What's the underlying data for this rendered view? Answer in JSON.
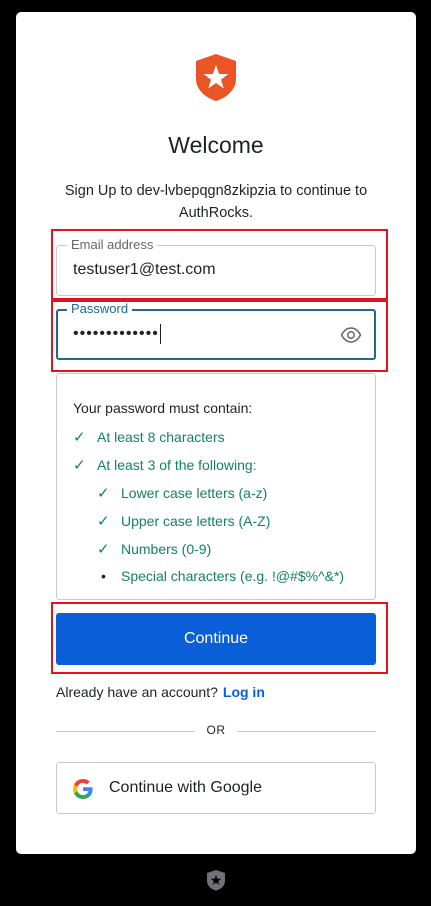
{
  "brand": {
    "accent_color": "#eb5424",
    "button_color": "#0a5fd8",
    "link_color": "#0a5fd8",
    "success_color": "#13825f",
    "logo_icon": "auth0-shield-star-icon"
  },
  "header": {
    "title": "Welcome",
    "subtitle": "Sign Up to dev-lvbepqgn8zkipzia to continue to AuthRocks."
  },
  "email": {
    "label": "Email address",
    "value": "testuser1@test.com"
  },
  "password": {
    "label": "Password",
    "value_masked": "•••••••••••••",
    "toggle_icon": "eye-icon"
  },
  "policy": {
    "heading": "Your password must contain:",
    "rules": [
      {
        "text": "At least 8 characters",
        "status": "met"
      },
      {
        "text": "At least 3 of the following:",
        "status": "met"
      },
      {
        "text": "Lower case letters (a-z)",
        "status": "met"
      },
      {
        "text": "Upper case letters (A-Z)",
        "status": "met"
      },
      {
        "text": "Numbers (0-9)",
        "status": "met"
      },
      {
        "text": "Special characters (e.g. !@#$%^&*)",
        "status": "unmet"
      }
    ],
    "met_symbol": "✓",
    "unmet_symbol": "•"
  },
  "actions": {
    "continue_label": "Continue",
    "already_text": "Already have an account?",
    "login_label": "Log in",
    "or_label": "OR",
    "google_label": "Continue with Google",
    "google_icon": "google-g-icon"
  },
  "footer": {
    "icon": "auth0-badge-icon"
  }
}
